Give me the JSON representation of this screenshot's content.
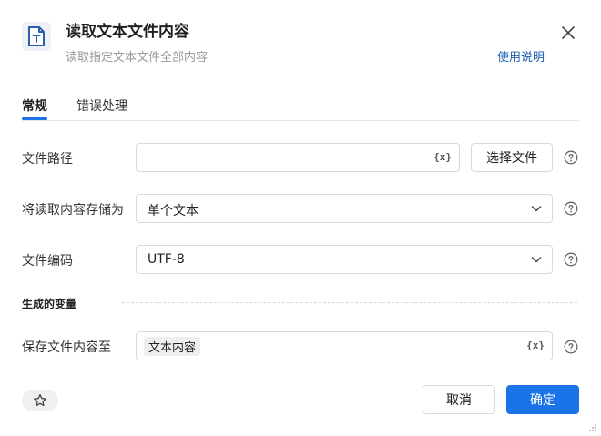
{
  "header": {
    "title": "读取文本文件内容",
    "subtitle": "读取指定文本文件全部内容",
    "help_link": "使用说明",
    "icon": "text-file-icon"
  },
  "tabs": [
    {
      "label": "常规",
      "active": true
    },
    {
      "label": "错误处理",
      "active": false
    }
  ],
  "form": {
    "file_path": {
      "label": "文件路径",
      "value": "",
      "var_button": "{x}",
      "choose_button": "选择文件"
    },
    "store_as": {
      "label": "将读取内容存储为",
      "value": "单个文本"
    },
    "encoding": {
      "label": "文件编码",
      "value": "UTF-8"
    }
  },
  "output_section": {
    "title": "生成的变量",
    "save_to": {
      "label": "保存文件内容至",
      "variable": "文本内容",
      "var_button": "{x}"
    }
  },
  "footer": {
    "cancel_label": "取消",
    "ok_label": "确定"
  },
  "colors": {
    "primary": "#1a73e8",
    "link": "#1a5fb4",
    "border": "#d9d9d9",
    "muted_text": "#9a9a9a"
  }
}
